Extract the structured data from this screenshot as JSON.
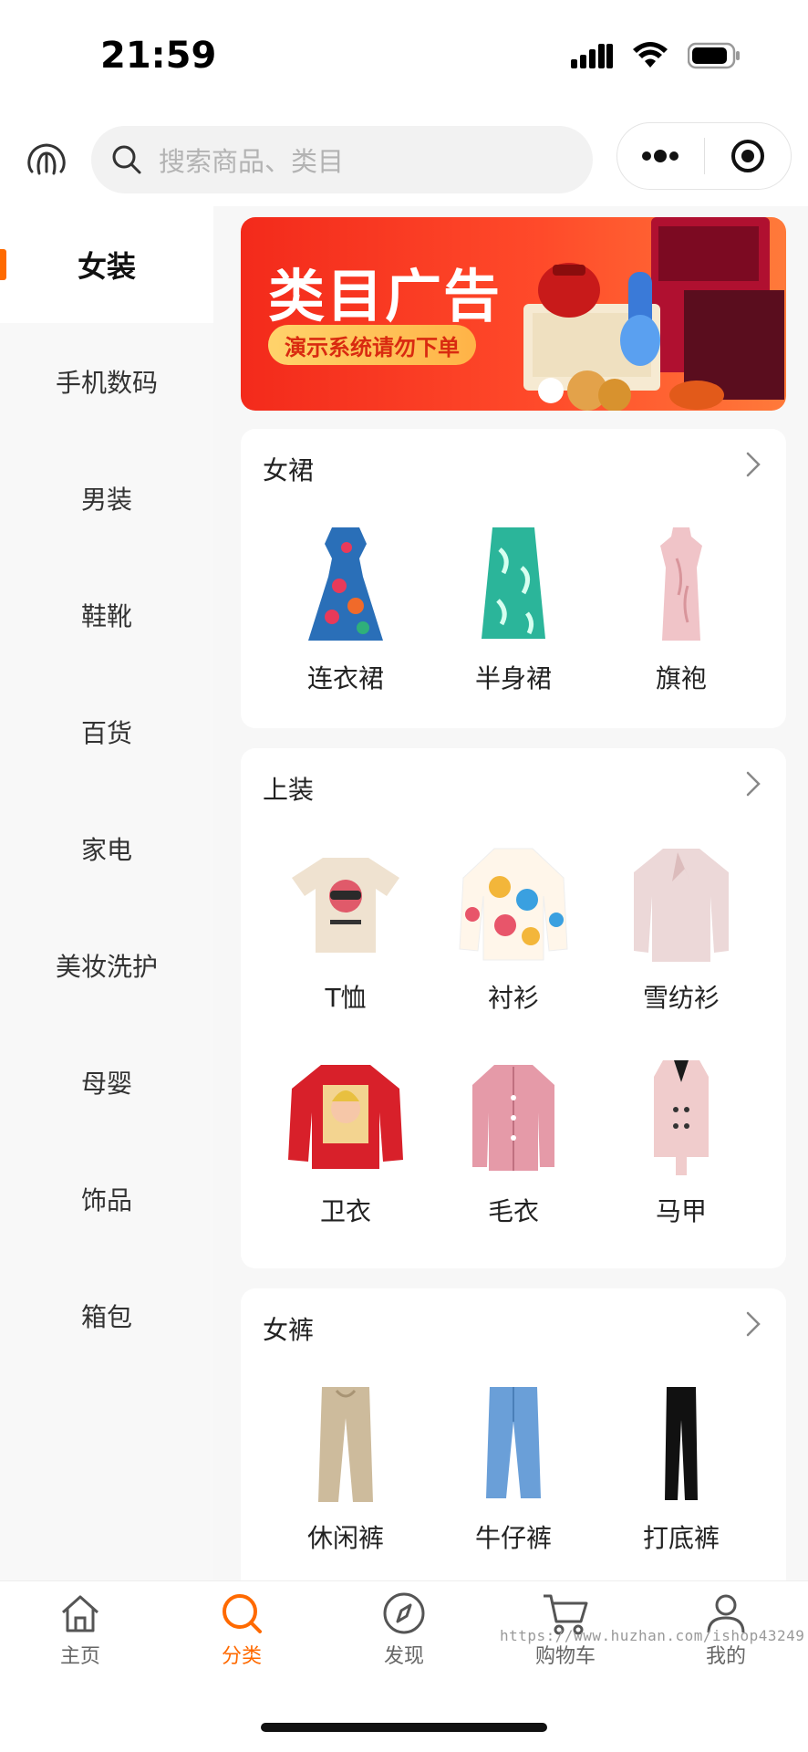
{
  "status_bar": {
    "time": "21:59"
  },
  "header": {
    "search_placeholder": "搜索商品、类目"
  },
  "sidebar": {
    "items": [
      {
        "label": "女装",
        "active": true
      },
      {
        "label": "手机数码"
      },
      {
        "label": "男装"
      },
      {
        "label": "鞋靴"
      },
      {
        "label": "百货"
      },
      {
        "label": "家电"
      },
      {
        "label": "美妆洗护"
      },
      {
        "label": "母婴"
      },
      {
        "label": "饰品"
      },
      {
        "label": "箱包"
      }
    ]
  },
  "banner": {
    "title": "类目广告",
    "subtitle": "演示系统请勿下单"
  },
  "sections": [
    {
      "title": "女裙",
      "items": [
        {
          "label": "连衣裙"
        },
        {
          "label": "半身裙"
        },
        {
          "label": "旗袍"
        }
      ]
    },
    {
      "title": "上装",
      "items": [
        {
          "label": "T恤"
        },
        {
          "label": "衬衫"
        },
        {
          "label": "雪纺衫"
        },
        {
          "label": "卫衣"
        },
        {
          "label": "毛衣"
        },
        {
          "label": "马甲"
        }
      ]
    },
    {
      "title": "女裤",
      "items": [
        {
          "label": "休闲裤"
        },
        {
          "label": "牛仔裤"
        },
        {
          "label": "打底裤"
        }
      ]
    }
  ],
  "tabbar": {
    "items": [
      {
        "label": "主页",
        "icon": "home-icon"
      },
      {
        "label": "分类",
        "icon": "search-icon",
        "active": true
      },
      {
        "label": "发现",
        "icon": "compass-icon"
      },
      {
        "label": "购物车",
        "icon": "cart-icon"
      },
      {
        "label": "我的",
        "icon": "user-icon"
      }
    ],
    "watermark": "https://www.huzhan.com/ishop43249"
  },
  "colors": {
    "accent": "#ff6a00",
    "banner_red": "#f32a1b"
  }
}
